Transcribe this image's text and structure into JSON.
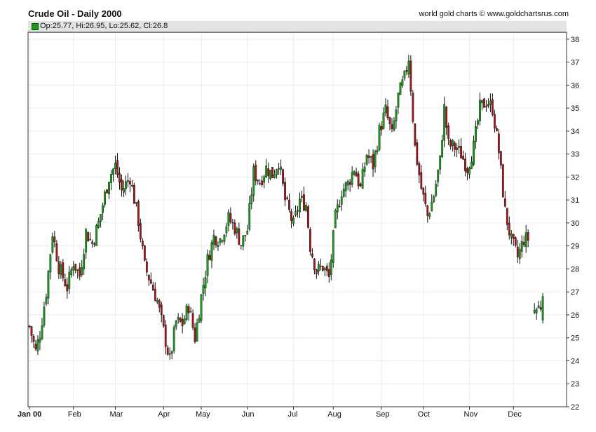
{
  "header": {
    "title": "Crude Oil - Daily 2000",
    "credit": "world gold charts © www.goldchartsrus.com",
    "ohlc_summary": "Op:25.77, Hi:26.95, Lo:25.62, Cl:26.8"
  },
  "colors": {
    "up": "#1a9a1a",
    "down": "#a01818",
    "grid": "#e6ecf2",
    "axis": "#333333"
  },
  "chart_data": {
    "type": "candlestick",
    "title": "Crude Oil - Daily 2000",
    "xlabel": "",
    "ylabel": "",
    "ylim": [
      22,
      38.3
    ],
    "yticks": [
      22,
      23,
      24,
      25,
      26,
      27,
      28,
      29,
      30,
      31,
      32,
      33,
      34,
      35,
      36,
      37,
      38
    ],
    "xlim_index": [
      0,
      255
    ],
    "month_ticks": [
      {
        "label": "Jan 00",
        "index": 0
      },
      {
        "label": "Feb",
        "index": 21
      },
      {
        "label": "Mar",
        "index": 41
      },
      {
        "label": "Apr",
        "index": 64
      },
      {
        "label": "May",
        "index": 82
      },
      {
        "label": "Jun",
        "index": 104
      },
      {
        "label": "Jul",
        "index": 126
      },
      {
        "label": "Aug",
        "index": 145
      },
      {
        "label": "Sep",
        "index": 168
      },
      {
        "label": "Oct",
        "index": 188
      },
      {
        "label": "Nov",
        "index": 210
      },
      {
        "label": "Dec",
        "index": 231
      }
    ],
    "anchors": [
      [
        0,
        25.5
      ],
      [
        3,
        24.4
      ],
      [
        5,
        25.2
      ],
      [
        8,
        27.0
      ],
      [
        11,
        29.6
      ],
      [
        14,
        28.1
      ],
      [
        18,
        27.2
      ],
      [
        21,
        28.3
      ],
      [
        24,
        27.7
      ],
      [
        27,
        29.6
      ],
      [
        30,
        29.1
      ],
      [
        33,
        30.0
      ],
      [
        38,
        32.0
      ],
      [
        41,
        32.5
      ],
      [
        44,
        31.4
      ],
      [
        48,
        32.0
      ],
      [
        52,
        30.1
      ],
      [
        55,
        28.1
      ],
      [
        58,
        27.4
      ],
      [
        61,
        26.6
      ],
      [
        64,
        25.3
      ],
      [
        67,
        24.0
      ],
      [
        70,
        25.7
      ],
      [
        73,
        25.6
      ],
      [
        76,
        26.4
      ],
      [
        79,
        25.0
      ],
      [
        82,
        26.8
      ],
      [
        85,
        28.4
      ],
      [
        88,
        29.4
      ],
      [
        91,
        29.3
      ],
      [
        95,
        30.2
      ],
      [
        98,
        29.8
      ],
      [
        101,
        29.1
      ],
      [
        104,
        29.7
      ],
      [
        107,
        32.2
      ],
      [
        110,
        31.8
      ],
      [
        113,
        32.4
      ],
      [
        116,
        32.1
      ],
      [
        119,
        32.7
      ],
      [
        122,
        31.0
      ],
      [
        126,
        29.9
      ],
      [
        129,
        31.0
      ],
      [
        132,
        30.8
      ],
      [
        134,
        29.0
      ],
      [
        137,
        27.9
      ],
      [
        140,
        28.1
      ],
      [
        143,
        27.6
      ],
      [
        146,
        30.2
      ],
      [
        149,
        31.4
      ],
      [
        152,
        31.7
      ],
      [
        155,
        32.4
      ],
      [
        158,
        31.5
      ],
      [
        161,
        33.0
      ],
      [
        164,
        32.5
      ],
      [
        167,
        34.0
      ],
      [
        170,
        34.9
      ],
      [
        173,
        33.8
      ],
      [
        176,
        35.5
      ],
      [
        179,
        36.3
      ],
      [
        181,
        37.2
      ],
      [
        184,
        33.3
      ],
      [
        187,
        31.5
      ],
      [
        190,
        30.3
      ],
      [
        193,
        31.2
      ],
      [
        196,
        32.7
      ],
      [
        198,
        35.0
      ],
      [
        200,
        33.4
      ],
      [
        203,
        33.3
      ],
      [
        206,
        33.0
      ],
      [
        209,
        32.4
      ],
      [
        212,
        33.3
      ],
      [
        215,
        35.0
      ],
      [
        218,
        35.3
      ],
      [
        221,
        35.0
      ],
      [
        224,
        33.1
      ],
      [
        227,
        30.5
      ],
      [
        230,
        29.2
      ],
      [
        233,
        28.5
      ],
      [
        236,
        29.3
      ],
      [
        238,
        29.3
      ],
      [
        241,
        26.2
      ],
      [
        244,
        26.4
      ],
      [
        245,
        26.8
      ]
    ],
    "gaps": [
      [
        239,
        240
      ]
    ],
    "last_candle": {
      "open": 25.77,
      "high": 26.95,
      "low": 25.62,
      "close": 26.8
    }
  }
}
